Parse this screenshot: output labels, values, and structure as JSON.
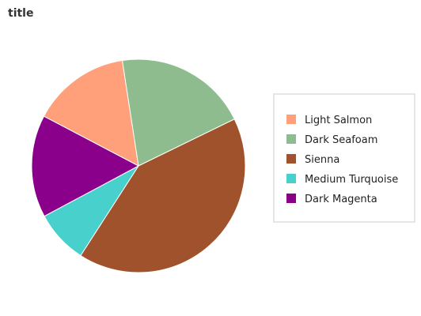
{
  "chart_data": {
    "type": "pie",
    "title": "title",
    "categories": [
      "Light Salmon",
      "Dark Seafoam",
      "Sienna",
      "Medium Turquoise",
      "Dark Magenta"
    ],
    "values": [
      14,
      19,
      38.9,
      7.6,
      14.6
    ],
    "colors": [
      "#ffa07a",
      "#8fbc8f",
      "#a0522d",
      "#48d1cc",
      "#8b008b"
    ],
    "legend_position": "right",
    "legend": [
      {
        "label": "Light Salmon",
        "color": "#ffa07a"
      },
      {
        "label": "Dark Seafoam",
        "color": "#8fbc8f"
      },
      {
        "label": "Sienna",
        "color": "#a0522d"
      },
      {
        "label": "Medium Turquoise",
        "color": "#48d1cc"
      },
      {
        "label": "Dark Magenta",
        "color": "#8b008b"
      }
    ]
  }
}
